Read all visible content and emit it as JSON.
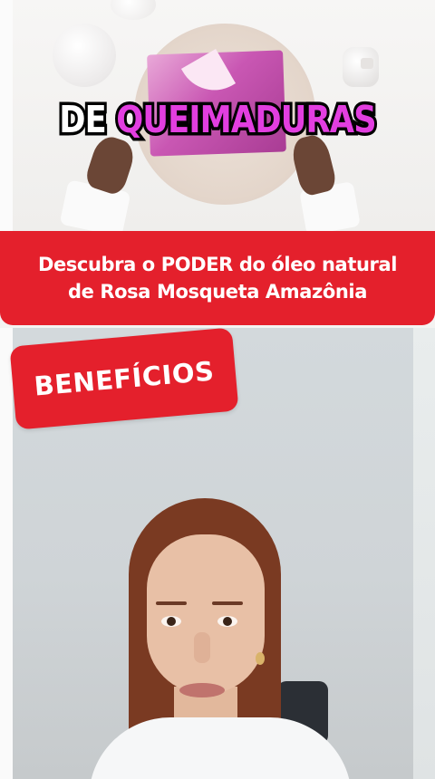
{
  "top_caption": {
    "word_white": "DE",
    "word_pink": "QUEIMADURAS"
  },
  "banner": {
    "line1": "Descubra o PODER do óleo natural",
    "line2": "de Rosa Mosqueta Amazônia"
  },
  "badge": {
    "label": "BENEFÍCIOS"
  },
  "colors": {
    "banner_red": "#e4202c",
    "caption_pink": "#e23ee0",
    "caption_white": "#ffffff",
    "caption_stroke": "#000000"
  }
}
